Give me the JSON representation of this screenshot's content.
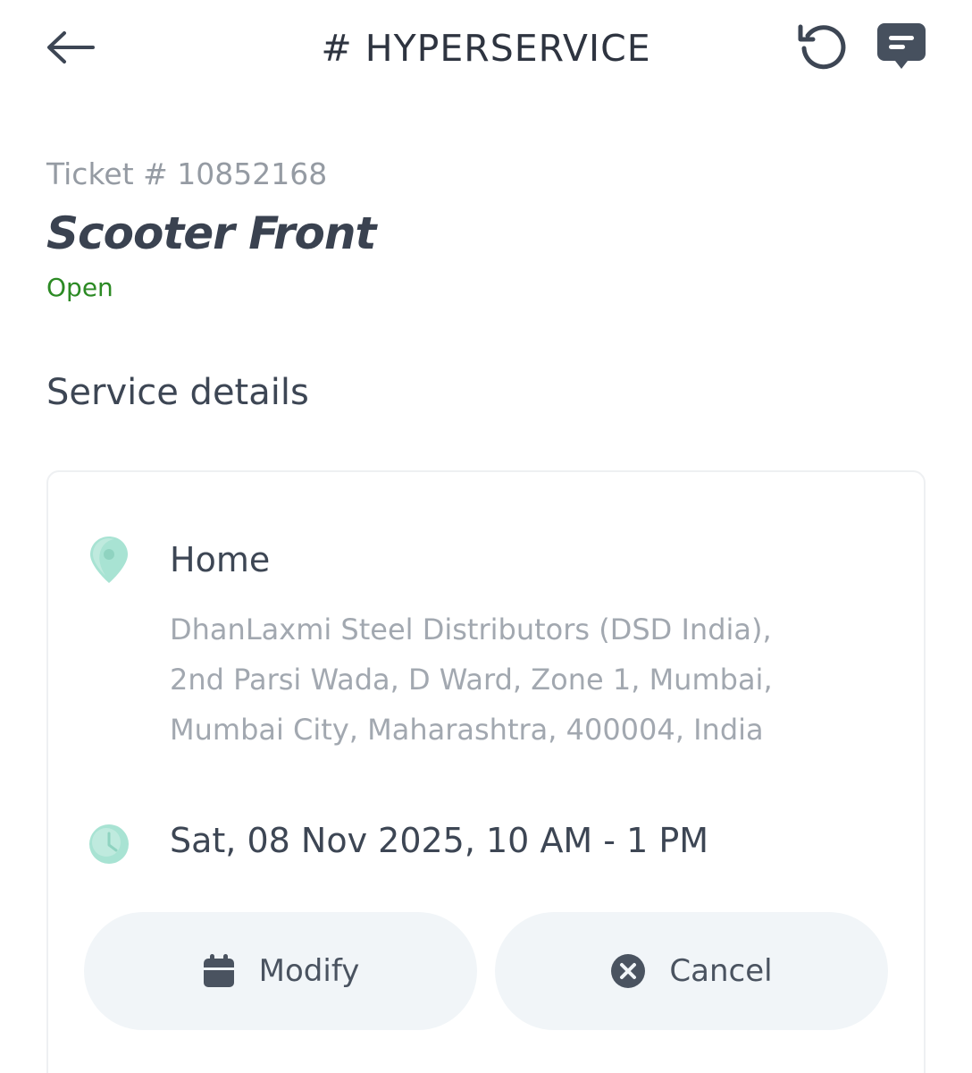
{
  "header": {
    "brand": "# HYPERSERVICE",
    "back_icon": "arrow-left-icon",
    "refresh_icon": "history-icon",
    "chat_icon": "chat-bubble-icon"
  },
  "ticket": {
    "number": "Ticket # 10852168",
    "title": "Scooter Front",
    "status": "Open"
  },
  "section": {
    "title": "Service details"
  },
  "service": {
    "location_icon": "map-pin-icon",
    "location_name": "Home",
    "address": "DhanLaxmi Steel Distributors (DSD India), 2nd Parsi Wada, D Ward, Zone 1, Mumbai, Mumbai City, Maharashtra, 400004, India",
    "time_icon": "clock-icon",
    "slot": "Sat, 08 Nov 2025, 10 AM - 1 PM"
  },
  "actions": {
    "modify_label": "Modify",
    "modify_icon": "calendar-icon",
    "cancel_label": "Cancel",
    "cancel_icon": "close-circle-icon"
  },
  "colors": {
    "status_open": "#2c8a24",
    "accent_teal": "#a8e3d3",
    "button_bg": "#f1f5f8",
    "text_primary": "#3d4654",
    "text_muted": "#a2a8b0"
  }
}
